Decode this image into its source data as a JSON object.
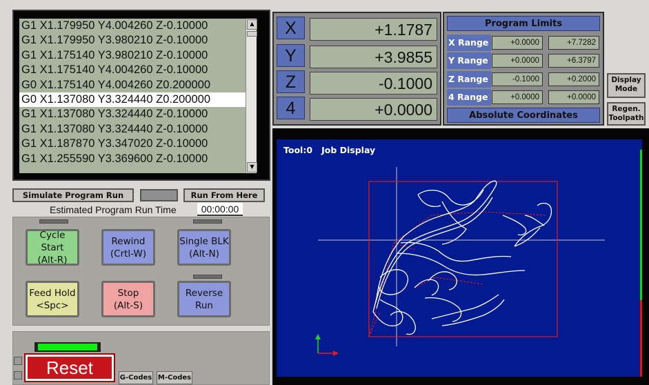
{
  "gcode": {
    "lines": [
      "G1 X1.179950 Y4.004260 Z-0.10000",
      "G1 X1.179950 Y3.980210 Z-0.10000",
      "G1 X1.175140 Y3.980210 Z-0.10000",
      "G1 X1.175140 Y4.004260 Z-0.10000",
      "G0 X1.175140 Y4.004260 Z0.200000",
      "G0 X1.137080 Y3.324440 Z0.200000",
      "G1 X1.137080 Y3.324440 Z-0.10000",
      "G1 X1.137080 Y3.324440 Z-0.10000",
      "G1 X1.187870 Y3.347020 Z-0.10000",
      "G1 X1.255590 Y3.369600 Z-0.10000"
    ],
    "selected_index": 5
  },
  "dro": {
    "axes": [
      {
        "label": "X",
        "value": "+1.1787"
      },
      {
        "label": "Y",
        "value": "+3.9855"
      },
      {
        "label": "Z",
        "value": "-0.1000"
      },
      {
        "label": "4",
        "value": "+0.0000"
      }
    ]
  },
  "limits": {
    "title": "Program Limits",
    "rows": [
      {
        "label": "X Range",
        "min": "+0.0000",
        "max": "+7.7282"
      },
      {
        "label": "Y Range",
        "min": "+0.0000",
        "max": "+6.3797"
      },
      {
        "label": "Z Range",
        "min": "-0.1000",
        "max": "+0.2000"
      },
      {
        "label": "4 Range",
        "min": "+0.0000",
        "max": "+0.0000"
      }
    ],
    "footer": "Absolute Coordinates"
  },
  "side_buttons": {
    "display_mode_1": "Display",
    "display_mode_2": "Mode",
    "regen_1": "Regen.",
    "regen_2": "Toolpath"
  },
  "toolpath": {
    "label": "Tool:0   Job Display"
  },
  "sim": {
    "simulate": "Simulate Program Run",
    "run_from_here": "Run From Here",
    "est_label": "Estimated Program Run Time",
    "est_time": "00:00:00"
  },
  "controls": {
    "cycle_start": [
      "Cycle Start",
      "(Alt-R)"
    ],
    "rewind": [
      "Rewind",
      "(Crtl-W)"
    ],
    "single_blk": [
      "Single BLK",
      "(Alt-N)"
    ],
    "feed_hold": [
      "Feed Hold",
      "<Spc>"
    ],
    "stop": [
      "Stop",
      "(Alt-S)"
    ],
    "reverse_run": [
      "Reverse",
      "Run"
    ]
  },
  "reset": {
    "label": "Reset",
    "gcodes": "G-Codes",
    "mcodes": "M-Codes"
  },
  "colors": {
    "dro_bg": "#a9b59e",
    "axis_btn": "#5c70b8",
    "toolpath_bg": "#041a90",
    "reset_red": "#c8151c",
    "led_green": "#11ee11"
  }
}
